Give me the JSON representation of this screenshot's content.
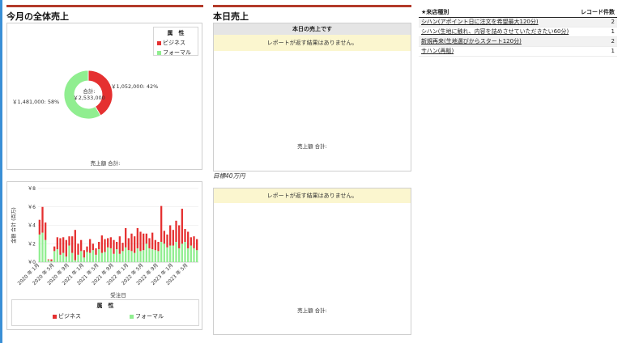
{
  "monthly": {
    "title": "今月の全体売上",
    "legend_title": "属　性",
    "legend_items": [
      {
        "label": "ビジネス",
        "color": "#e53030"
      },
      {
        "label": "フォーマル",
        "color": "#90ee90"
      }
    ],
    "center_label": "合計:",
    "center_value": "￥2,533,000",
    "label_right": "￥1,052,000: 42%",
    "label_left": "￥1,481,000: 58%",
    "footer": "売上額 合計:"
  },
  "daily": {
    "title": "本日売上",
    "report_header": "本日の売上です",
    "no_results_1": "レポートが返す結果はありません。",
    "footer_1": "売上額 合計:",
    "target_label": "目標40万円",
    "no_results_2": "レポートが返す結果はありません。",
    "footer_2": "売上額 合計:"
  },
  "records": {
    "col_type": "★来店種別",
    "col_count": "レコード件数",
    "rows": [
      {
        "type": "シハン(アポイント日に注文を希望最大120分)",
        "count": "2"
      },
      {
        "type": "シハン(生地に触れ、内容を詰めさせていただきたい60分)",
        "count": "1"
      },
      {
        "type": "新規再来(生地選びからスタート120分)",
        "count": "2"
      },
      {
        "type": "サハン(再販)",
        "count": "1"
      }
    ]
  },
  "history_chart": {
    "ylabel": "金額 合計 (百万)",
    "xlabel": "受注日",
    "legend_title": "属　性",
    "legend_items": [
      {
        "label": "ビジネス",
        "color": "#e53030"
      },
      {
        "label": "フォーマル",
        "color": "#90ee90"
      }
    ]
  },
  "chart_data": [
    {
      "type": "pie",
      "labels": [
        "ビジネス",
        "フォーマル"
      ],
      "values": [
        1052000,
        1481000
      ],
      "percent": [
        42,
        58
      ],
      "colors": [
        "#e53030",
        "#90ee90"
      ]
    },
    {
      "type": "bar",
      "stacked": true,
      "ylim": [
        0,
        8
      ],
      "yticks": [
        "￥0",
        "￥2",
        "￥4",
        "￥6",
        "￥8"
      ],
      "tick_labels": [
        "2020 年 1月",
        "2020 年 5月",
        "2020 年 9月",
        "2021 年 1月",
        "2021 年 5月",
        "2021 年 9月",
        "2022 年 1月",
        "2022 年 5月",
        "2022 年 9月",
        "2023 年 1月",
        "2023 年 5月"
      ],
      "series": [
        {
          "name": "フォーマル",
          "color": "#90ee90",
          "values": [
            3.0,
            3.2,
            2.4,
            0.2,
            0.1,
            1.2,
            1.4,
            0.8,
            1.0,
            0.6,
            1.8,
            1.0,
            0.2,
            0.8,
            1.2,
            0.5,
            1.1,
            1.0,
            1.3,
            0.8,
            1.4,
            1.0,
            1.1,
            1.6,
            1.5,
            0.9,
            1.4,
            0.9,
            1.2,
            1.6,
            1.3,
            1.2,
            1.0,
            1.5,
            1.2,
            1.3,
            2.0,
            1.5,
            1.4,
            1.3,
            1.2,
            2.2,
            2.0,
            1.6,
            1.8,
            1.8,
            2.2,
            1.5,
            2.0,
            2.2,
            1.5,
            1.8,
            1.5,
            1.3
          ]
        },
        {
          "name": "ビジネス",
          "color": "#e53030",
          "values": [
            1.6,
            2.8,
            1.9,
            0.1,
            0.2,
            0.5,
            1.3,
            1.8,
            1.7,
            1.8,
            1.0,
            1.8,
            3.3,
            1.2,
            1.2,
            0.8,
            0.6,
            1.5,
            0.7,
            0.7,
            0.8,
            1.9,
            1.4,
            1.0,
            1.2,
            1.5,
            0.8,
            1.9,
            0.9,
            2.1,
            1.3,
            1.9,
            1.8,
            2.2,
            2.1,
            1.8,
            1.1,
            1.1,
            1.8,
            1.1,
            1.0,
            3.9,
            1.4,
            1.4,
            2.2,
            1.7,
            2.3,
            2.5,
            3.8,
            1.4,
            1.8,
            0.9,
            1.3,
            1.2
          ]
        }
      ]
    }
  ]
}
